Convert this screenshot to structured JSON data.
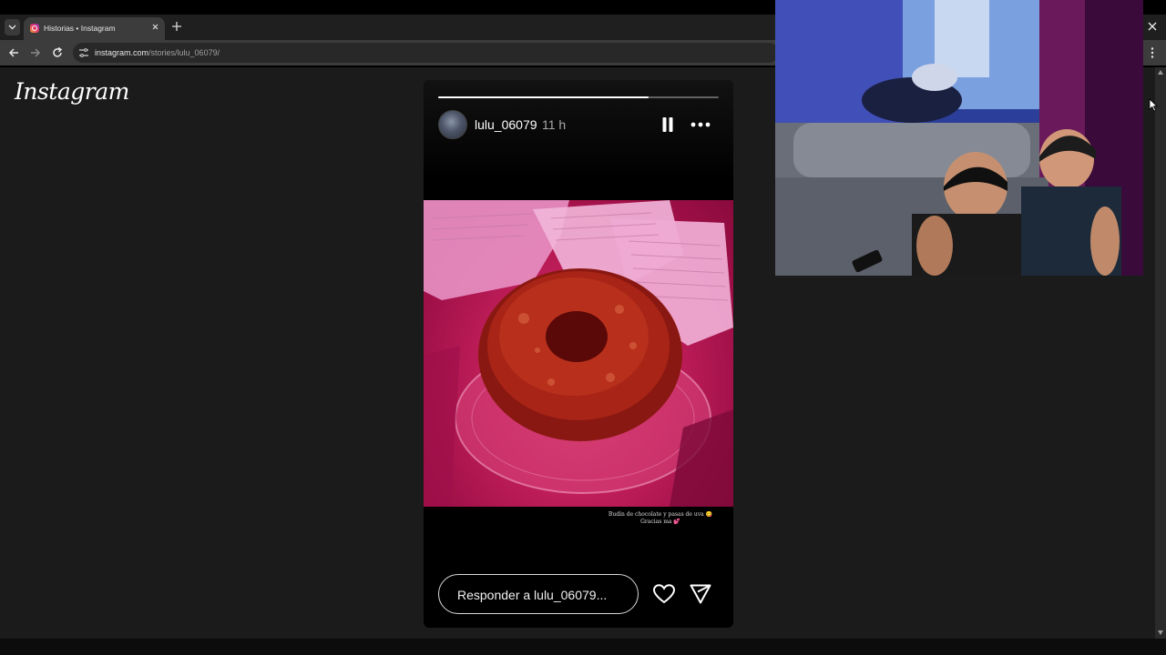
{
  "browser": {
    "tab_title": "Historias • Instagram",
    "url_host": "instagram.com",
    "url_path": "/stories/lulu_06079/"
  },
  "page": {
    "logo_text": "Instagram"
  },
  "story": {
    "progress": 0.75,
    "username": "lulu_06079",
    "time": "11 h",
    "caption_line1": "Budín de chocolate y pasas de uva 😋",
    "caption_line2": "Gracias ma 💕",
    "reply_placeholder": "Responder a lulu_06079..."
  },
  "colors": {
    "page_bg": "#1b1b1b",
    "photo_tint": "#c21f5a"
  },
  "icons": {
    "pause": "pause-icon",
    "more": "more-options-icon",
    "like": "heart-icon",
    "share": "send-icon"
  }
}
